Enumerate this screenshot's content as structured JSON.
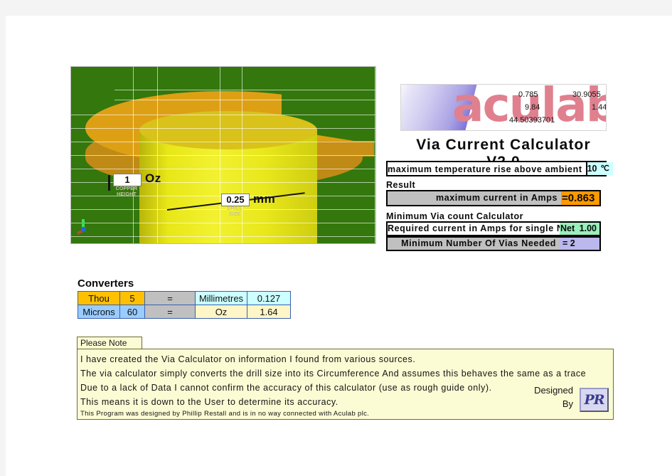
{
  "app": {
    "title": "Via Current Calculator V2.0",
    "logo_word": "aculab"
  },
  "logo_numbers": {
    "n1": "0.785",
    "n2": "30.9055",
    "n3": "9.84",
    "n4": "1.44",
    "n5": "44.50393701"
  },
  "figure": {
    "copper_height_value": "1",
    "copper_height_unit": "Oz",
    "copper_height_caption_line1": "COPPER",
    "copper_height_caption_line2": "HEIGHT",
    "drill_size_value": "0.25",
    "drill_size_unit": "mm",
    "drill_size_caption_line1": "DRILL",
    "drill_size_caption_line2": "SIZE"
  },
  "temperature": {
    "label": "maximum temperature rise above ambient",
    "value": "10",
    "unit": "℃"
  },
  "result": {
    "section_label": "Result",
    "label": "maximum current in Amps",
    "value": "=0.863"
  },
  "via_count": {
    "section_label": "Minimum Via count Calculator",
    "required_label": "Required current in Amps for single Net",
    "required_value": "1.00",
    "required_overflow": "Net",
    "minimum_label": "Minimum Number Of Vias Needed",
    "minimum_value": "=   2"
  },
  "converters": {
    "title": "Converters",
    "rows": [
      {
        "from_unit": "Thou",
        "from_value": "5",
        "equals": "=",
        "to_unit": "Millimetres",
        "to_value": "0.127"
      },
      {
        "from_unit": "Microns",
        "from_value": "60",
        "equals": "=",
        "to_unit": "Oz",
        "to_value": "1.64"
      }
    ]
  },
  "note": {
    "tab_label": "Please Note",
    "lines": [
      "I have created the Via Calculator on information I found from various sources.",
      "The via calculator simply converts the drill size into its  Circumference And assumes this behaves the same as a trace",
      "Due to a lack of Data I cannot confirm the accuracy of this calculator (use as rough guide only).",
      "This means it is down to the User to determine its accuracy."
    ],
    "fine_print": "This Program was designed by Phillip Restall and is in no way connected with Aculab plc.",
    "designed_line1": "Designed",
    "designed_line2": "By",
    "pr_monogram": "PR"
  },
  "colors": {
    "result_orange": "#FF9900",
    "input_cyan": "#CCFFFF",
    "required_green": "#99EEBB",
    "vias_lavender": "#BBB8EE",
    "gray_cell": "#C0C0C0",
    "thou_gold": "#FFC000",
    "microns_blue": "#99CCFF",
    "cream": "#FFF6C8",
    "note_bg": "#FBFBD4",
    "figure_green": "#33770D"
  }
}
